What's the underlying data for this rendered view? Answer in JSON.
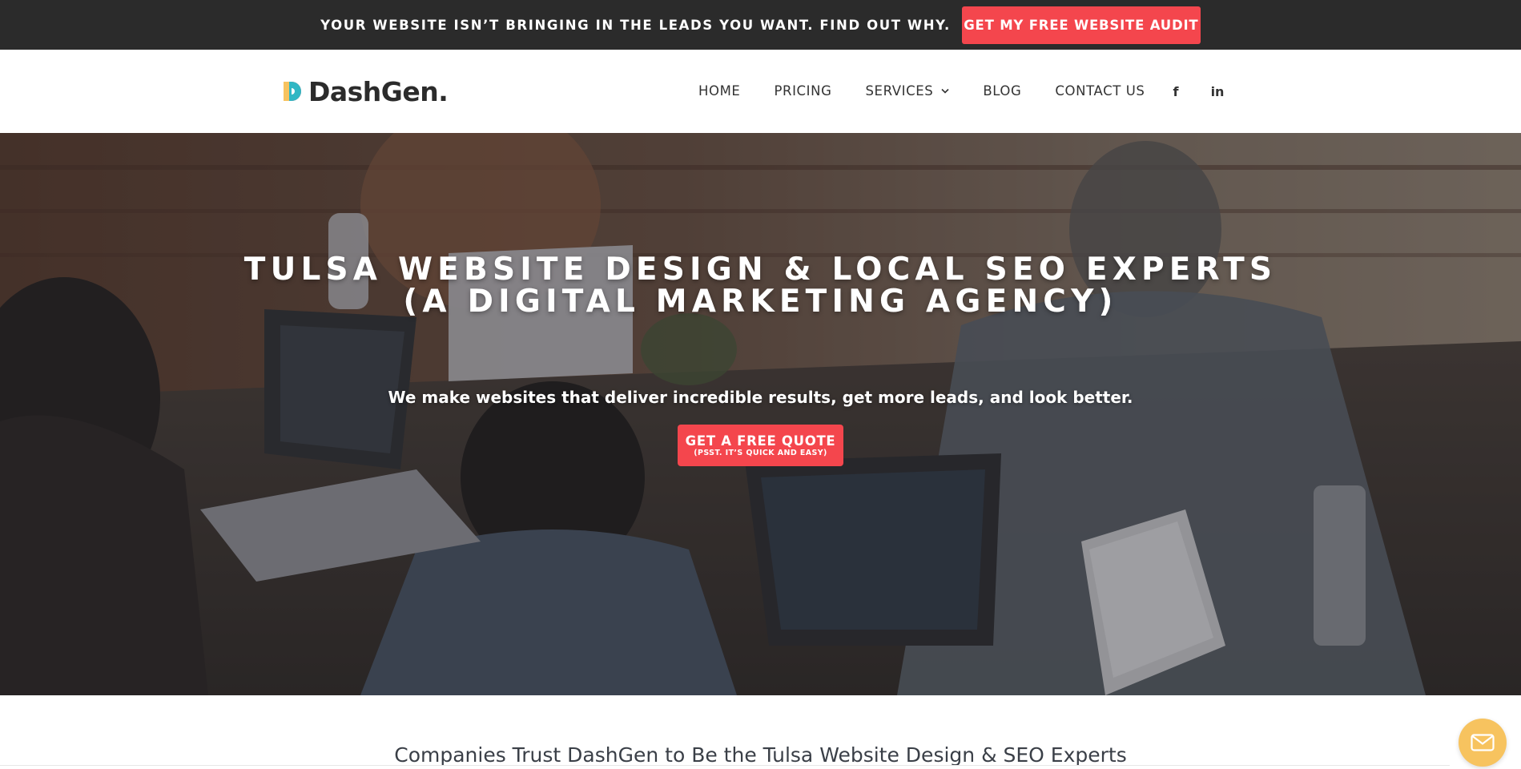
{
  "announcement": {
    "text": "YOUR WEBSITE ISN’T BRINGING IN THE LEADS YOU WANT. FIND OUT WHY.",
    "button_label": "GET MY FREE WEBSITE AUDIT"
  },
  "header": {
    "logo_text": "DashGen",
    "logo_dot": ".",
    "nav": {
      "home": "HOME",
      "pricing": "PRICING",
      "services": "SERVICES",
      "blog": "BLOG",
      "contact": "CONTACT US"
    },
    "social": {
      "facebook": "f",
      "linkedin": "in"
    }
  },
  "hero": {
    "title_line1": "TULSA WEBSITE DESIGN & LOCAL SEO EXPERTS",
    "title_line2": "(A DIGITAL MARKETING AGENCY)",
    "subtitle": "We make websites that deliver incredible results, get more leads, and look better.",
    "cta_main": "GET A FREE QUOTE",
    "cta_sub": "(PSST. IT’S QUICK AND EASY)"
  },
  "trust": {
    "heading": "Companies Trust DashGen to Be the Tulsa Website Design & SEO Experts"
  },
  "colors": {
    "accent": "#f4464d",
    "topbar": "#2b2b2b",
    "mail_button": "#f7c35f"
  },
  "icons": {
    "logo_mark": "dashgen-d-icon",
    "services_dropdown": "chevron-down-icon",
    "facebook": "facebook-icon",
    "linkedin": "linkedin-icon",
    "mail": "mail-icon"
  }
}
